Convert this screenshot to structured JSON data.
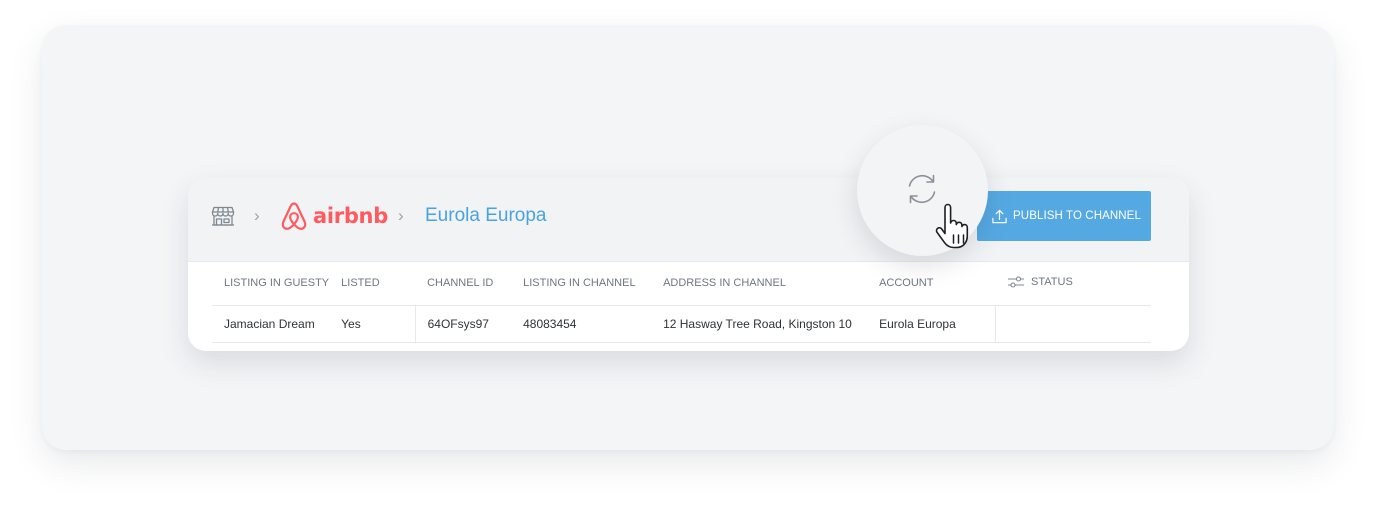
{
  "breadcrumb": {
    "brand_name": "airbnb",
    "current": "Eurola Europa"
  },
  "toolbar": {
    "publish_label": "PUBLISH TO CHANNEL"
  },
  "table": {
    "columns": [
      "LISTING IN GUESTY",
      "LISTED",
      "CHANNEL ID",
      "LISTING IN CHANNEL",
      "ADDRESS IN CHANNEL",
      "ACCOUNT",
      "STATUS"
    ],
    "rows": [
      [
        "Jamacian Dream",
        "Yes",
        "64OFsys97",
        "48083454",
        "12 Hasway Tree Road, Kingston 10",
        "Eurola Europa",
        ""
      ]
    ]
  },
  "icons": {
    "home": "store-icon",
    "refresh": "refresh-icon",
    "publish": "upload-icon",
    "status": "sliders-icon",
    "cursor": "hand-pointer-icon"
  },
  "colors": {
    "airbnb": "#ff5a5f",
    "accent": "#4aa3df",
    "button": "#55a9e3"
  }
}
